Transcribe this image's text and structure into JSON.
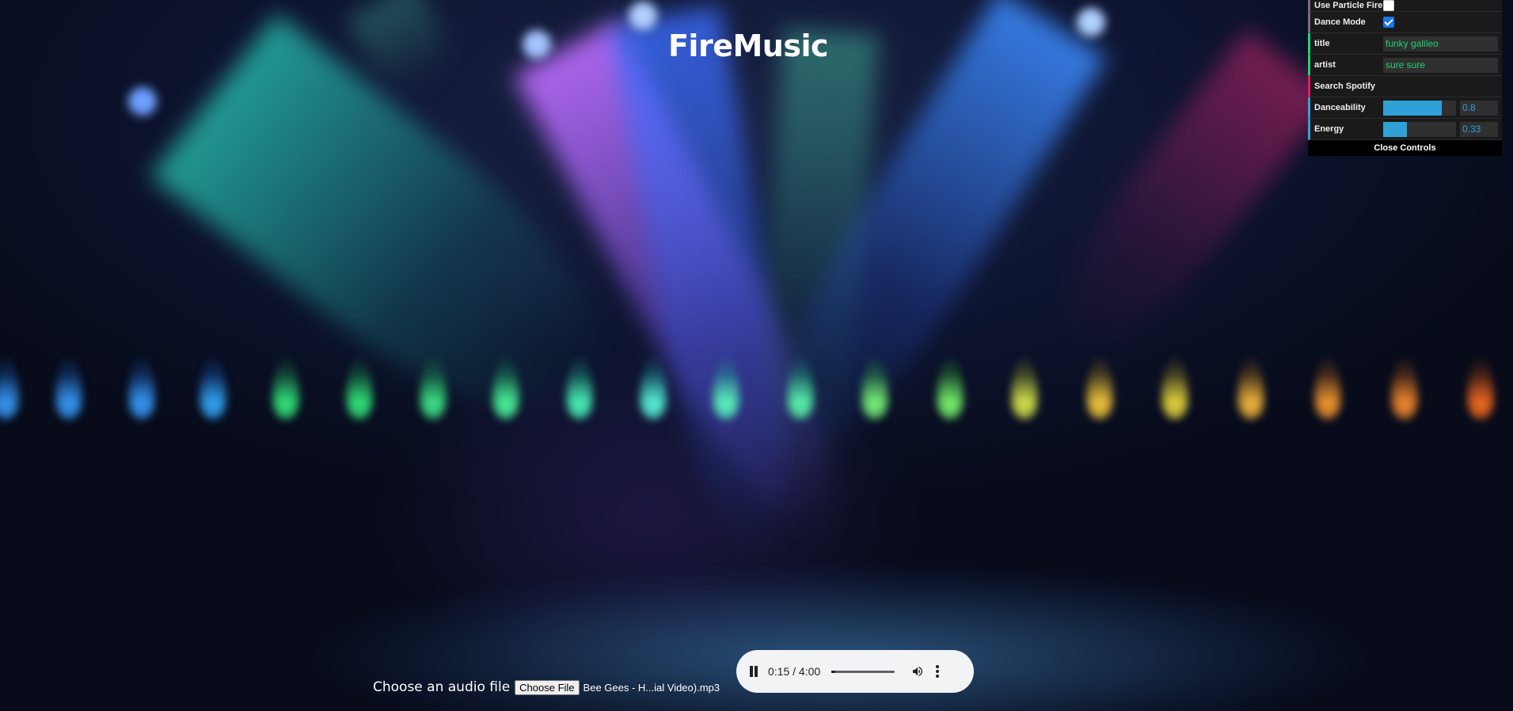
{
  "app": {
    "title": "FireMusic"
  },
  "controls": {
    "use_particle_fire": {
      "label": "Use Particle Fire",
      "checked": false
    },
    "dance_mode": {
      "label": "Dance Mode",
      "checked": true
    },
    "title_field": {
      "label": "title",
      "value": "funky galileo"
    },
    "artist_field": {
      "label": "artist",
      "value": "sure sure"
    },
    "search_label": "Search Spotify",
    "danceability": {
      "label": "Danceability",
      "value": "0.8",
      "fraction": 0.8
    },
    "energy": {
      "label": "Energy",
      "value": "0.33",
      "fraction": 0.33
    },
    "close_label": "Close Controls",
    "colors": {
      "checkbox": "#1ed36f",
      "string": "#1ed36f",
      "function": "#e61d5f",
      "number": "#2fa1d6"
    }
  },
  "file_input": {
    "label": "Choose an audio file",
    "button_label": "Choose File",
    "file_name": "Bee Gees - H...ial Video).mp3"
  },
  "player": {
    "time": "0:15 / 4:00",
    "progress": 0.0625,
    "icons": {
      "play_state": "pause-icon",
      "volume": "volume-icon",
      "menu": "more-vert-icon"
    }
  }
}
